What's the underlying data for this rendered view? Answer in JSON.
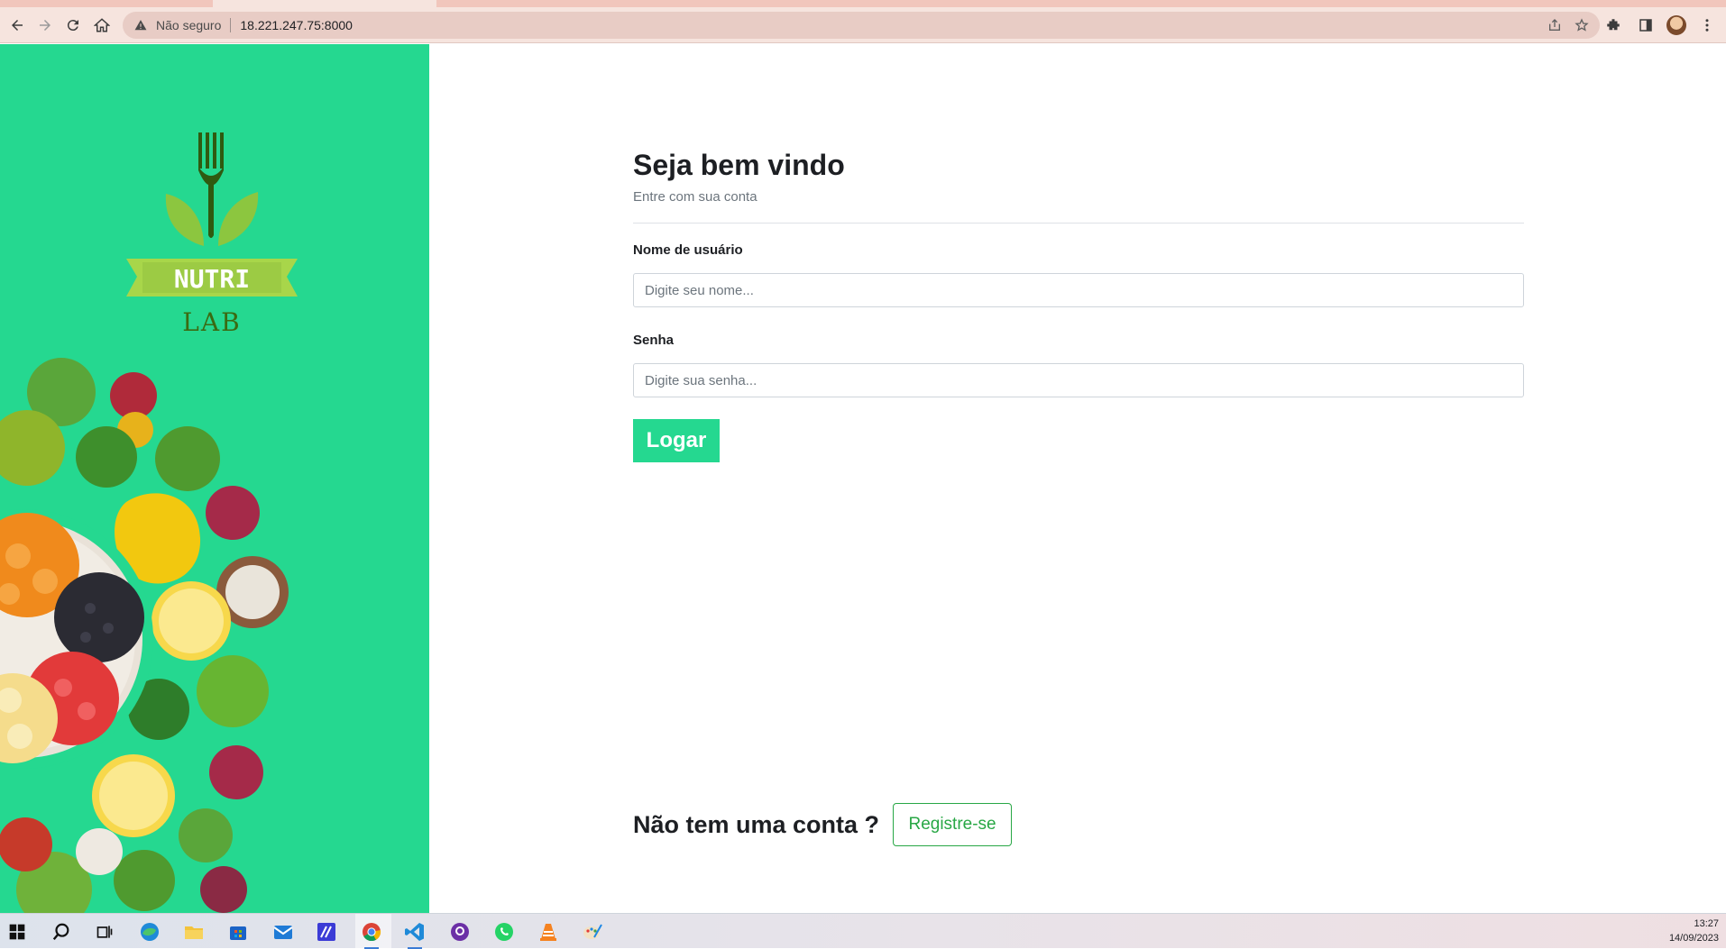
{
  "browser": {
    "security_label": "Não seguro",
    "url": "18.221.247.75:8000",
    "icons": [
      "back-icon",
      "forward-icon",
      "reload-icon",
      "home-icon",
      "warning-icon",
      "share-icon",
      "star-icon",
      "extensions-icon",
      "side-panel-icon",
      "profile-avatar",
      "menu-icon"
    ]
  },
  "brand": {
    "name_top": "NUTRI",
    "name_bottom": "LAB",
    "colors": {
      "panel": "#25d890",
      "leaf": "#8cc63f",
      "fork": "#2f5a10",
      "ribbon": "#a8d64a"
    }
  },
  "login": {
    "title": "Seja bem vindo",
    "subtitle": "Entre com sua conta",
    "username_label": "Nome de usuário",
    "username_placeholder": "Digite seu nome...",
    "password_label": "Senha",
    "password_placeholder": "Digite sua senha...",
    "submit_label": "Logar"
  },
  "register": {
    "question": "Não tem uma conta ?",
    "button_label": "Registre-se"
  },
  "taskbar": {
    "apps": [
      "windows-start-icon",
      "search-icon",
      "task-view-icon",
      "edge-icon",
      "file-explorer-icon",
      "store-icon",
      "mail-icon",
      "app-icon",
      "chrome-icon",
      "vscode-icon",
      "github-icon",
      "whatsapp-icon",
      "vlc-icon",
      "paint-icon"
    ],
    "time": "13:27",
    "date": "14/09/2023"
  }
}
